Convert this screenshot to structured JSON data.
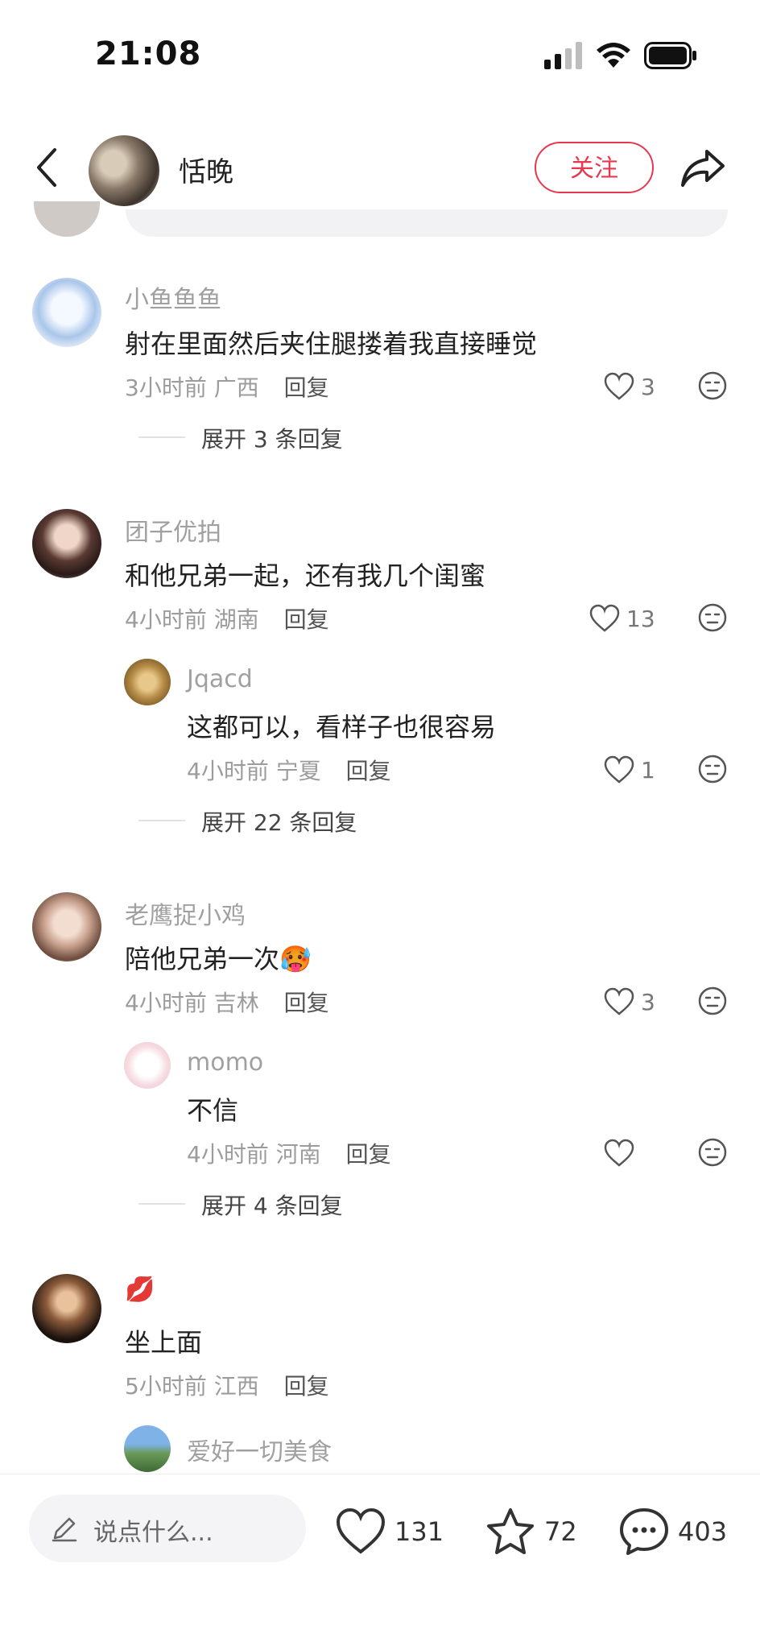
{
  "status_bar": {
    "time": "21:08"
  },
  "header": {
    "author_name": "恬晚",
    "follow_label": "关注"
  },
  "comments": [
    {
      "nickname": "小鱼鱼鱼",
      "text": "射在里面然后夹住腿搂着我直接睡觉",
      "time": "3小时前",
      "location": "广西",
      "reply_label": "回复",
      "likes": "3",
      "expand_label": "展开 3 条回复"
    },
    {
      "nickname": "团子优拍",
      "text": "和他兄弟一起，还有我几个闺蜜",
      "time": "4小时前",
      "location": "湖南",
      "reply_label": "回复",
      "likes": "13",
      "reply": {
        "nickname": "Jqacd",
        "text": "这都可以，看样子也很容易",
        "time": "4小时前",
        "location": "宁夏",
        "reply_label": "回复",
        "likes": "1"
      },
      "expand_label": "展开 22 条回复"
    },
    {
      "nickname": "老鹰捉小鸡",
      "text": "陪他兄弟一次",
      "emoji": "🥵",
      "time": "4小时前",
      "location": "吉林",
      "reply_label": "回复",
      "likes": "3",
      "reply": {
        "nickname": "momo",
        "text": "不信",
        "time": "4小时前",
        "location": "河南",
        "reply_label": "回复",
        "likes": ""
      },
      "expand_label": "展开 4 条回复"
    },
    {
      "nickname": "💋",
      "text": "坐上面",
      "time": "5小时前",
      "location": "江西",
      "reply_label": "回复",
      "reply": {
        "nickname": "爱好一切美食"
      }
    }
  ],
  "bottom_bar": {
    "input_placeholder": "说点什么...",
    "likes": "131",
    "favorites": "72",
    "comments": "403"
  },
  "colors": {
    "accent": "#e8384f"
  }
}
